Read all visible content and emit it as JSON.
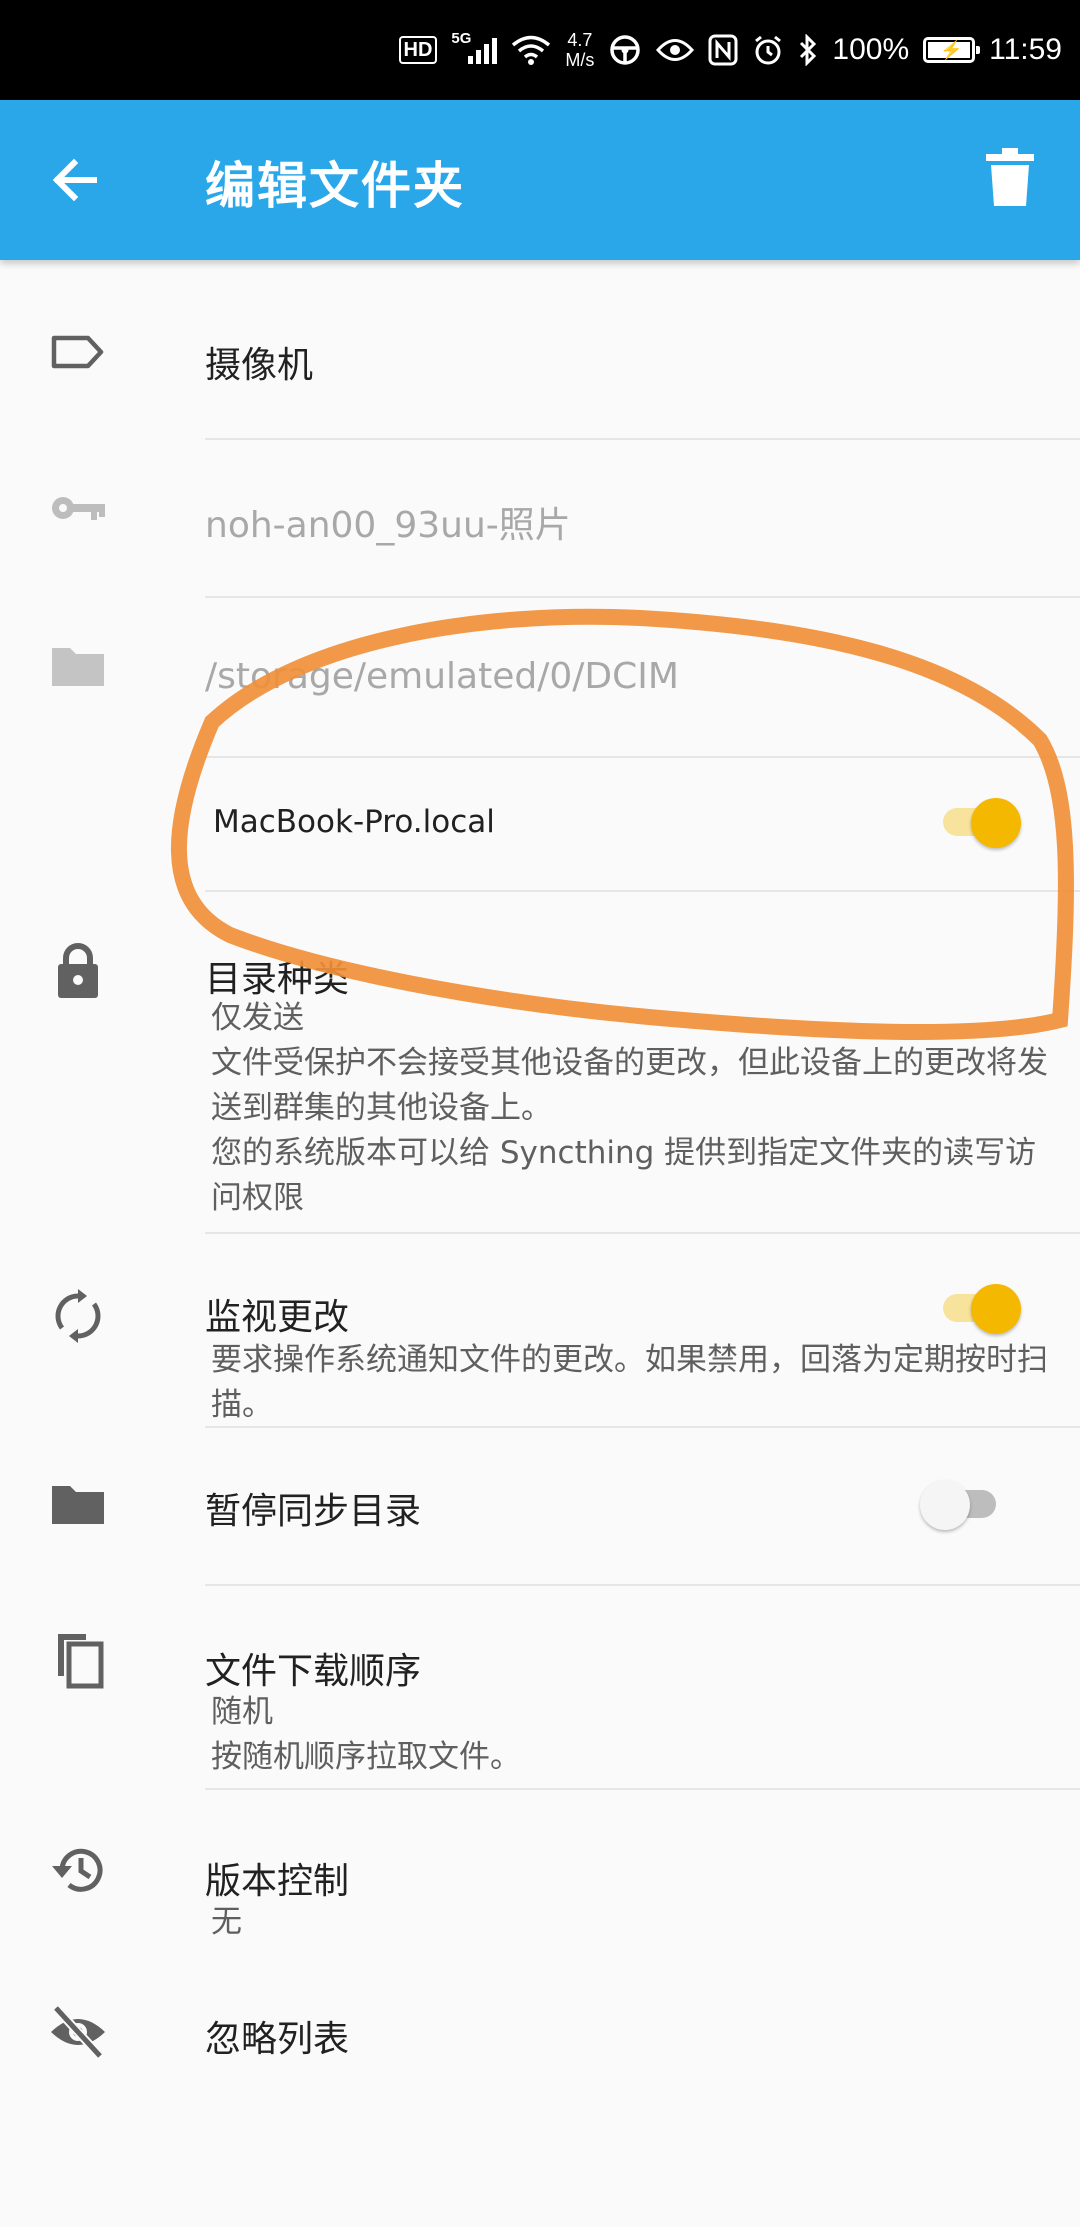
{
  "status_bar": {
    "hd": "HD",
    "network": "5G",
    "speed_value": "4.7",
    "speed_unit": "M/s",
    "battery": "100%",
    "time": "11:59"
  },
  "app_bar": {
    "title": "编辑文件夹",
    "back_icon": "arrow-left-icon",
    "delete_icon": "trash-icon",
    "color": "#29a7e9"
  },
  "folder": {
    "label": "摄像机",
    "id": "noh-an00_93uu-照片",
    "path": "/storage/emulated/0/DCIM"
  },
  "device": {
    "name": "MacBook-Pro.local",
    "shared": true
  },
  "folder_type": {
    "title": "目录种类",
    "value": "仅发送",
    "desc": "文件受保护不会接受其他设备的更改，但此设备上的更改将发送到群集的其他设备上。",
    "note": "您的系统版本可以给 Syncthing 提供到指定文件夹的读写访问权限"
  },
  "watch": {
    "title": "监视更改",
    "desc": "要求操作系统通知文件的更改。如果禁用，回落为定期按时扫描。",
    "enabled": true
  },
  "pause": {
    "title": "暂停同步目录",
    "enabled": false
  },
  "pull_order": {
    "title": "文件下载顺序",
    "value": "随机",
    "desc": "按随机顺序拉取文件。"
  },
  "versioning": {
    "title": "版本控制",
    "value": "无"
  },
  "ignore": {
    "title": "忽略列表"
  },
  "colors": {
    "accent": "#f5b800",
    "annotation": "#f0903a"
  }
}
